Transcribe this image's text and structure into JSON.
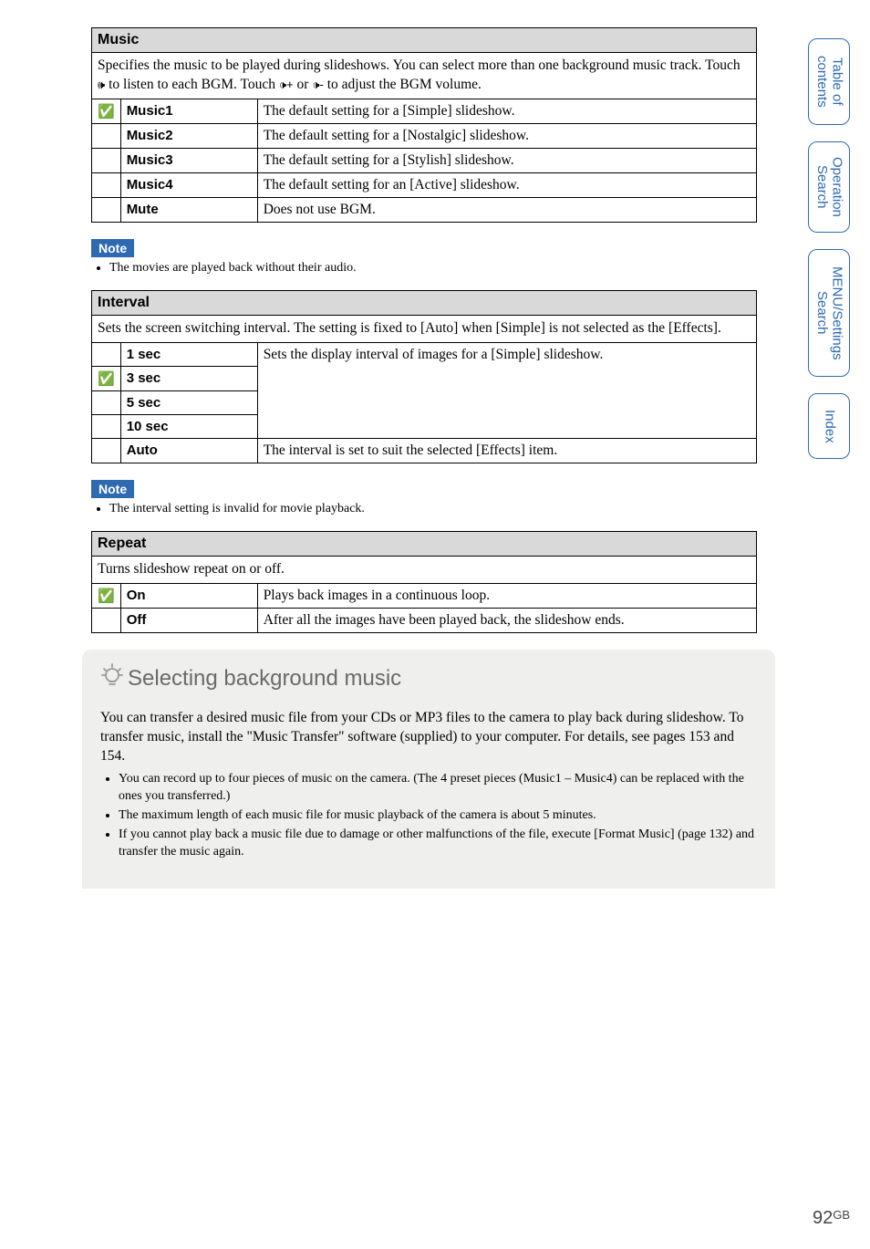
{
  "tabs": {
    "t1": "Table of\ncontents",
    "t2": "Operation\nSearch",
    "t3": "MENU/Settings\nSearch",
    "t4": "Index"
  },
  "check_glyph": "✅",
  "icons": {
    "listen": "🕪",
    "vol_up": "🕩+",
    "vol_down": "🕩-"
  },
  "music": {
    "head": "Music",
    "desc_pre": "Specifies the music to be played during slideshows. You can select more than one background music track. Touch ",
    "desc_mid1": " to listen to each BGM. Touch ",
    "desc_or": " or ",
    "desc_post": " to adjust the BGM volume.",
    "rows": [
      {
        "chk": true,
        "key": "Music1",
        "val": "The default setting for a [Simple] slideshow."
      },
      {
        "chk": false,
        "key": "Music2",
        "val": "The default setting for a [Nostalgic] slideshow."
      },
      {
        "chk": false,
        "key": "Music3",
        "val": "The default setting for a [Stylish] slideshow."
      },
      {
        "chk": false,
        "key": "Music4",
        "val": "The default setting for an [Active] slideshow."
      },
      {
        "chk": false,
        "key": "Mute",
        "val": "Does not use BGM."
      }
    ]
  },
  "note_label": "Note",
  "music_note": "The movies are played back without their audio.",
  "interval": {
    "head": "Interval",
    "desc": "Sets the screen switching interval. The setting is fixed to [Auto] when [Simple] is not selected as the [Effects].",
    "rows": [
      {
        "chk": false,
        "key": "1 sec",
        "val": "Sets the display interval of images for a [Simple] slideshow.",
        "merge_start": true
      },
      {
        "chk": true,
        "key": "3 sec"
      },
      {
        "chk": false,
        "key": "5 sec"
      },
      {
        "chk": false,
        "key": "10 sec"
      },
      {
        "chk": false,
        "key": "Auto",
        "val": "The interval is set to suit the selected [Effects] item."
      }
    ]
  },
  "interval_note": "The interval setting is invalid for movie playback.",
  "repeat": {
    "head": "Repeat",
    "desc": "Turns slideshow repeat on or off.",
    "rows": [
      {
        "chk": true,
        "key": "On",
        "val": "Plays back images in a continuous loop."
      },
      {
        "chk": false,
        "key": "Off",
        "val": "After all the images have been played back, the slideshow ends."
      }
    ]
  },
  "tip": {
    "title": "Selecting background music",
    "text": "You can transfer a desired music file from your CDs or MP3 files to the camera to play back during slideshow. To transfer music, install the \"Music Transfer\" software (supplied) to your computer. For details, see pages 153 and 154.",
    "bullets": [
      "You can record up to four pieces of music on the camera. (The 4 preset pieces (Music1 – Music4) can be replaced with the ones you transferred.)",
      "The maximum length of each music file for music playback of the camera is about 5 minutes.",
      "If you cannot play back a music file due to damage or other malfunctions of the file, execute [Format Music] (page 132) and transfer the music again."
    ]
  },
  "page_number": "92",
  "page_suffix": "GB"
}
